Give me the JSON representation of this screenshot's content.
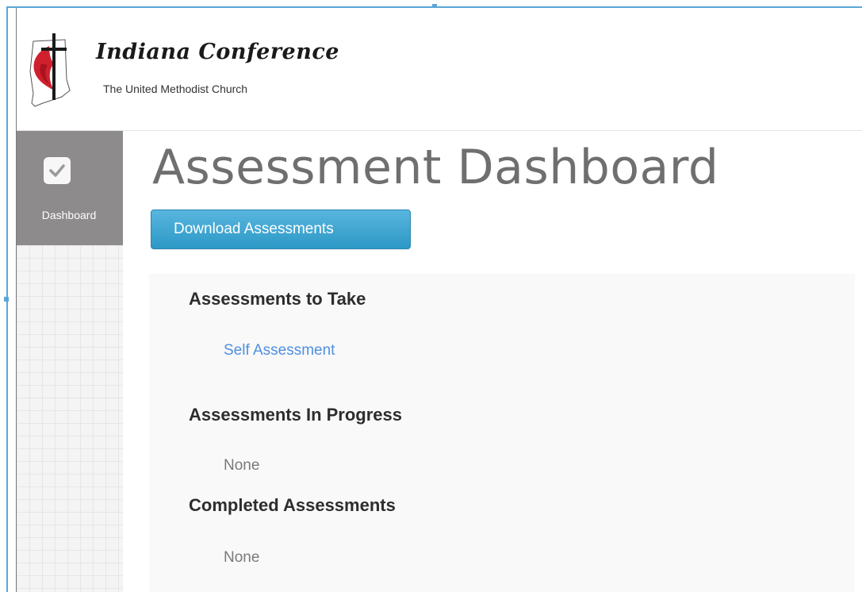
{
  "header": {
    "logo_title": "Indiana Conference",
    "logo_subtitle": "The United Methodist Church"
  },
  "sidebar": {
    "items": [
      {
        "label": "Dashboard",
        "icon": "checkbox-icon"
      }
    ]
  },
  "main": {
    "title": "Assessment Dashboard",
    "download_button": "Download Assessments",
    "sections": [
      {
        "heading": "Assessments to Take",
        "items": [
          "Self Assessment"
        ]
      },
      {
        "heading": "Assessments In Progress",
        "items": [
          "None"
        ]
      },
      {
        "heading": "Completed Assessments",
        "items": [
          "None"
        ]
      }
    ]
  },
  "colors": {
    "button": "#34a2d0",
    "sidebar_active": "#8d8b8c",
    "link": "#4f8fe0",
    "logo_red": "#d0202e"
  }
}
